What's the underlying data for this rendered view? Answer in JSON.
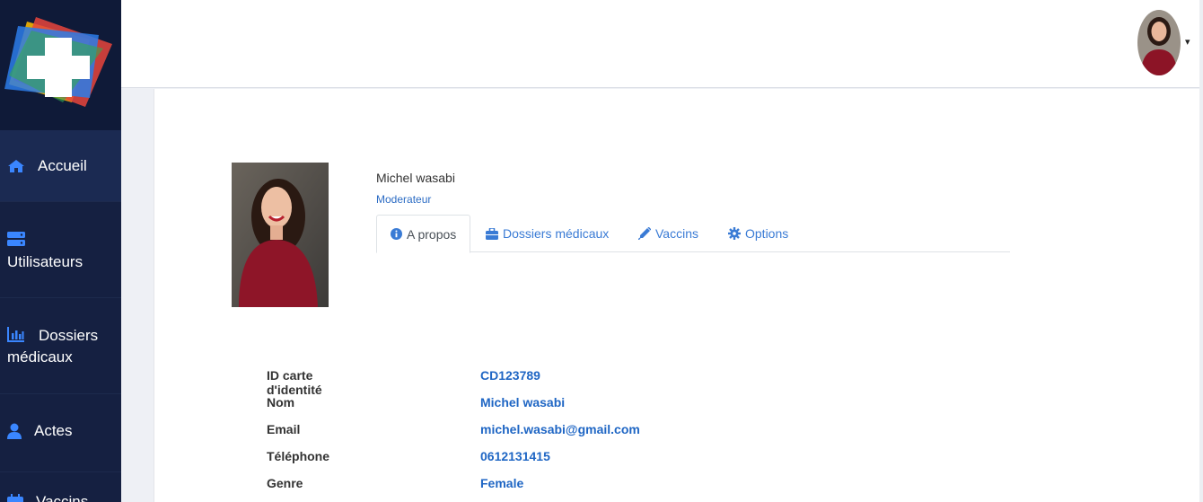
{
  "sidebar": {
    "items": [
      {
        "label": "Accueil",
        "icon": "home-icon"
      },
      {
        "label": "Utilisateurs",
        "icon": "server-icon"
      },
      {
        "label_line1": "Dossiers",
        "label_line2": "médicaux",
        "icon": "bar-chart-icon"
      },
      {
        "label": "Actes",
        "icon": "user-icon"
      },
      {
        "label": "Vaccins",
        "icon": "calendar-icon"
      }
    ],
    "colors": {
      "background": "#152041",
      "active": "#1b2a52",
      "icon": "#3a86ff"
    }
  },
  "header": {
    "avatar_icon": "user-avatar",
    "menu_caret": "▾"
  },
  "profile": {
    "name": "Michel wasabi",
    "role": "Moderateur",
    "tabs": [
      {
        "label": "A propos",
        "icon": "info-circle-icon"
      },
      {
        "label": "Dossiers médicaux",
        "icon": "briefcase-icon"
      },
      {
        "label": "Vaccins",
        "icon": "syringe-icon"
      },
      {
        "label": "Options",
        "icon": "gear-icon"
      }
    ],
    "details": [
      {
        "label": "ID carte d'identité",
        "value": "CD123789"
      },
      {
        "label": "Nom",
        "value": "Michel wasabi"
      },
      {
        "label": "Email",
        "value": "michel.wasabi@gmail.com"
      },
      {
        "label": "Téléphone",
        "value": "0612131415"
      },
      {
        "label": "Genre",
        "value": "Female"
      }
    ]
  },
  "colors": {
    "accent": "#1f66c4",
    "link": "#3a7bd5"
  }
}
